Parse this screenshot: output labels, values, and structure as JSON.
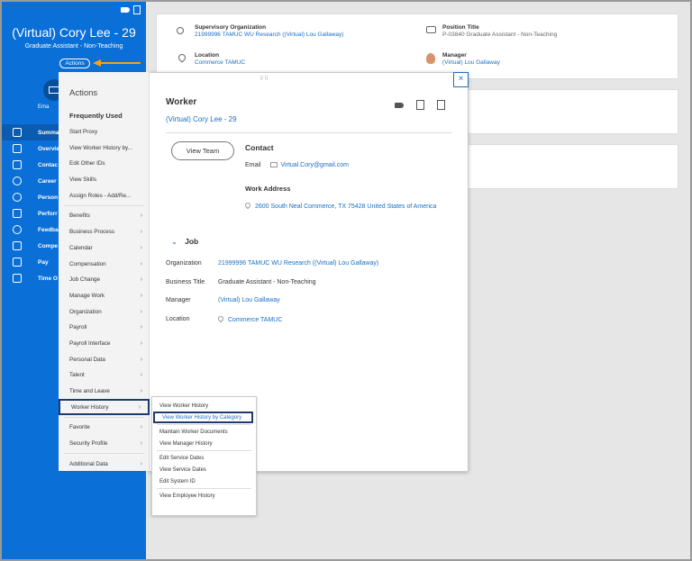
{
  "profile": {
    "name": "(Virtual) Cory Lee - 29",
    "title": "Graduate Assistant - Non-Teaching",
    "actions_label": "Actions",
    "email_label": "Ema",
    "accent_color": "#0a6fd6",
    "highlight_arrow_color": "#f3a50c"
  },
  "sidebar_nav": [
    {
      "label": "Summa",
      "icon": "grid-icon"
    },
    {
      "label": "Overvie",
      "icon": "overview-icon"
    },
    {
      "label": "Contac",
      "icon": "contact-icon"
    },
    {
      "label": "Career",
      "icon": "target-icon"
    },
    {
      "label": "Person",
      "icon": "person-icon"
    },
    {
      "label": "Perforr",
      "icon": "performance-icon"
    },
    {
      "label": "Feedba",
      "icon": "star-icon"
    },
    {
      "label": "Compe",
      "icon": "compensation-icon"
    },
    {
      "label": "Pay",
      "icon": "wallet-icon"
    },
    {
      "label": "Time O",
      "icon": "calendar-icon"
    }
  ],
  "summary_card": {
    "sup_org_label": "Supervisory Organization",
    "sup_org_value": "21999996 TAMUC WU Research ((Virtual) Lou Gallaway)",
    "position_label": "Position Title",
    "position_value": "P-03840 Graduate Assistant - Non-Teaching",
    "location_label": "Location",
    "location_value": "Commerce TAMUC",
    "manager_label": "Manager",
    "manager_value": "(Virtual) Lou Gallaway"
  },
  "worker_popup": {
    "drag_handle": "⠿⠿",
    "close_label": "×",
    "title": "Worker",
    "name": "(Virtual) Cory Lee - 29",
    "view_team_label": "View Team",
    "contact_heading": "Contact",
    "email_key": "Email",
    "email_value": "Virtual.Cory@gmail.com",
    "work_address_heading": "Work Address",
    "work_address_value": "2600 South Neal Commerce, TX 75428 United States of America",
    "job_heading": "Job",
    "job_rows": [
      {
        "key": "Organization",
        "value": "21999996 TAMUC WU Research ((Virtual) Lou Gallaway)"
      },
      {
        "key": "Business Title",
        "value": "Graduate Assistant - Non-Teaching"
      },
      {
        "key": "Manager",
        "value": "(Virtual) Lou Gallaway"
      },
      {
        "key": "Location",
        "value": "Commerce TAMUC"
      }
    ]
  },
  "actions_menu": {
    "title": "Actions",
    "frequently_used_heading": "Frequently Used",
    "frequent": [
      "Start Proxy",
      "View Worker History by...",
      "Edit Other IDs",
      "View Skills",
      "Assign Roles - Add/Re..."
    ],
    "categories": [
      "Benefits",
      "Business Process",
      "Calendar",
      "Compensation",
      "Job Change",
      "Manage Work",
      "Organization",
      "Payroll",
      "Payroll Interface",
      "Personal Data",
      "Talent",
      "Time and Leave",
      "Worker History"
    ],
    "secondary": [
      "Favorite",
      "Security Profile"
    ],
    "additional": [
      "Additional Data"
    ],
    "chevron": "›"
  },
  "worker_history_submenu": {
    "items_group1": [
      "View Worker History",
      "View Worker History by Category"
    ],
    "items_group2": [
      "Maintain Worker Documents",
      "View Manager History"
    ],
    "items_group3": [
      "Edit Service Dates",
      "View Service Dates",
      "Edit System ID"
    ],
    "items_group4": [
      "View Employee History"
    ]
  }
}
